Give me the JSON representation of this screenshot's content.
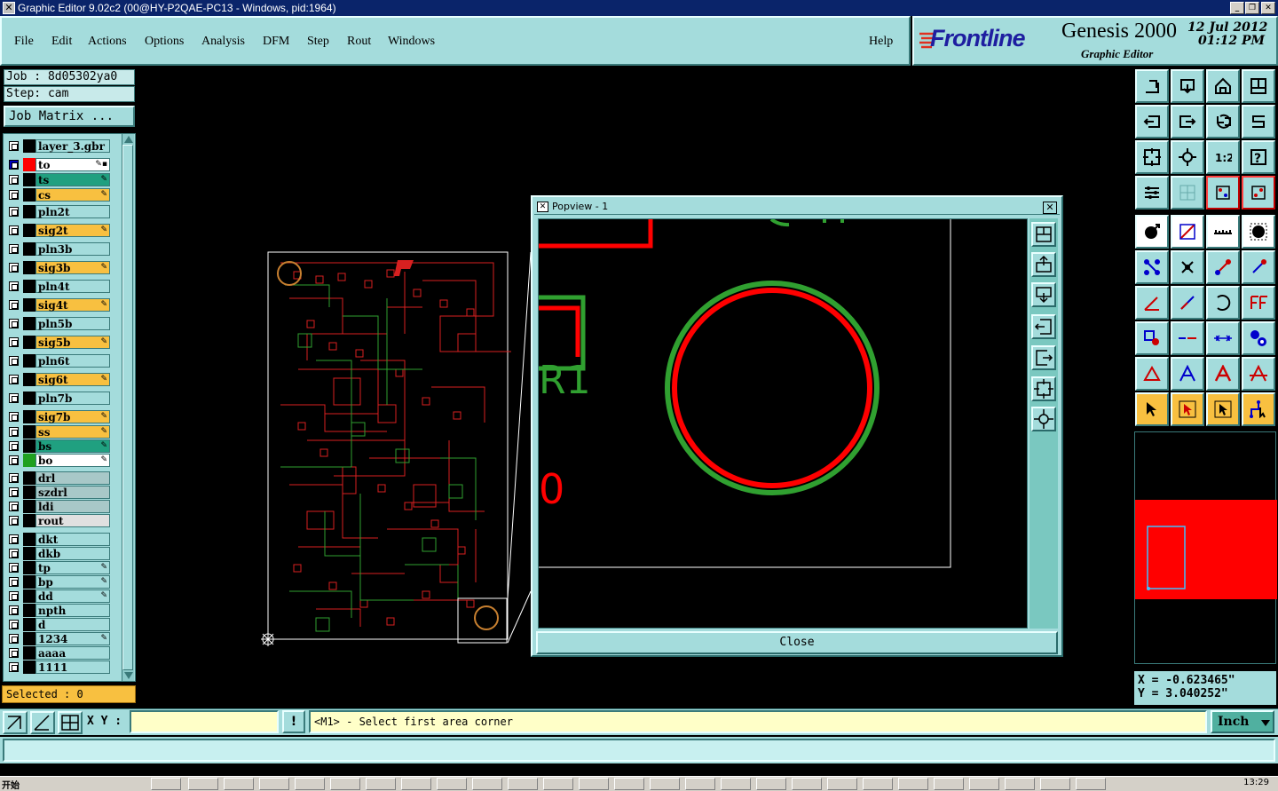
{
  "window": {
    "title": "Graphic Editor 9.02c2 (00@HY-P2QAE-PC13 - Windows, pid:1964)",
    "min": "_",
    "max": "❐",
    "close": "✕"
  },
  "menu": {
    "file": "File",
    "edit": "Edit",
    "actions": "Actions",
    "options": "Options",
    "analysis": "Analysis",
    "dfm": "DFM",
    "step": "Step",
    "rout": "Rout",
    "windows": "Windows",
    "help": "Help"
  },
  "brand": {
    "logo": "Frontline",
    "product": "Genesis 2000",
    "subtitle": "Graphic Editor",
    "date": "12 Jul 2012",
    "time": "01:12 PM"
  },
  "job": {
    "job": "Job : 8d05302ya0",
    "step": "Step: cam",
    "matrix_button": "Job Matrix ..."
  },
  "layers": [
    {
      "name": "layer_3.gbr",
      "color": "#a4dcdc",
      "swatch": "#000",
      "flag": ""
    },
    {
      "name": "to",
      "color": "#ffffff",
      "swatch": "#ff0000",
      "flag": "✎▪",
      "active": true
    },
    {
      "name": "ts",
      "color": "#20a080",
      "swatch": "#000",
      "flag": "✎"
    },
    {
      "name": "cs",
      "color": "#f8c040",
      "swatch": "#000",
      "flag": "✎"
    },
    {
      "name": "pln2t",
      "color": "#a4dcdc",
      "swatch": "#000",
      "flag": ""
    },
    {
      "name": "sig2t",
      "color": "#f8c040",
      "swatch": "#000",
      "flag": "✎"
    },
    {
      "name": "pln3b",
      "color": "#a4dcdc",
      "swatch": "#000",
      "flag": ""
    },
    {
      "name": "sig3b",
      "color": "#f8c040",
      "swatch": "#000",
      "flag": "✎"
    },
    {
      "name": "pln4t",
      "color": "#a4dcdc",
      "swatch": "#000",
      "flag": ""
    },
    {
      "name": "sig4t",
      "color": "#f8c040",
      "swatch": "#000",
      "flag": "✎"
    },
    {
      "name": "pln5b",
      "color": "#a4dcdc",
      "swatch": "#000",
      "flag": ""
    },
    {
      "name": "sig5b",
      "color": "#f8c040",
      "swatch": "#000",
      "flag": "✎"
    },
    {
      "name": "pln6t",
      "color": "#a4dcdc",
      "swatch": "#000",
      "flag": ""
    },
    {
      "name": "sig6t",
      "color": "#f8c040",
      "swatch": "#000",
      "flag": "✎"
    },
    {
      "name": "pln7b",
      "color": "#a4dcdc",
      "swatch": "#000",
      "flag": ""
    },
    {
      "name": "sig7b",
      "color": "#f8c040",
      "swatch": "#000",
      "flag": "✎"
    },
    {
      "name": "ss",
      "color": "#f8c040",
      "swatch": "#000",
      "flag": "✎"
    },
    {
      "name": "bs",
      "color": "#20a080",
      "swatch": "#000",
      "flag": "✎"
    },
    {
      "name": "bo",
      "color": "#ffffff",
      "swatch": "#20a020",
      "flag": "✎"
    },
    {
      "name": "drl",
      "color": "#a8c8c8",
      "swatch": "#000",
      "flag": ""
    },
    {
      "name": "szdrl",
      "color": "#a8c8c8",
      "swatch": "#000",
      "flag": ""
    },
    {
      "name": "ldi",
      "color": "#a8c8c8",
      "swatch": "#000",
      "flag": ""
    },
    {
      "name": "rout",
      "color": "#e0e0e0",
      "swatch": "#000",
      "flag": ""
    },
    {
      "name": "dkt",
      "color": "#a4dcdc",
      "swatch": "#000",
      "flag": ""
    },
    {
      "name": "dkb",
      "color": "#a4dcdc",
      "swatch": "#000",
      "flag": ""
    },
    {
      "name": "tp",
      "color": "#a4dcdc",
      "swatch": "#000",
      "flag": "✎"
    },
    {
      "name": "bp",
      "color": "#a4dcdc",
      "swatch": "#000",
      "flag": "✎"
    },
    {
      "name": "dd",
      "color": "#a4dcdc",
      "swatch": "#000",
      "flag": "✎"
    },
    {
      "name": "npth",
      "color": "#a4dcdc",
      "swatch": "#000",
      "flag": ""
    },
    {
      "name": "d",
      "color": "#a4dcdc",
      "swatch": "#000",
      "flag": ""
    },
    {
      "name": "1234",
      "color": "#a4dcdc",
      "swatch": "#000",
      "flag": "✎"
    },
    {
      "name": "aaaa",
      "color": "#a4dcdc",
      "swatch": "#000",
      "flag": ""
    },
    {
      "name": "1111",
      "color": "#a4dcdc",
      "swatch": "#000",
      "flag": ""
    }
  ],
  "selected": "Selected : 0",
  "popview": {
    "title": "Popview - 1",
    "close_label": "Close",
    "close_x": "✕",
    "pad_label": "0",
    "text_label": "R1"
  },
  "coords": {
    "x": "X = -0.623465\"",
    "y": "Y = 3.040252\""
  },
  "status": {
    "xy_label": "X Y :",
    "xy_value": "",
    "prompt": "<M1> - Select first area corner",
    "units": "Inch",
    "warn": "!"
  },
  "taskbar": {
    "start": "开始",
    "clock": "13:29"
  },
  "colors": {
    "panel": "#a4dcdc",
    "copper_top": "#ff0000",
    "copper_bottom": "#20a020",
    "highlight": "#f8c040"
  }
}
